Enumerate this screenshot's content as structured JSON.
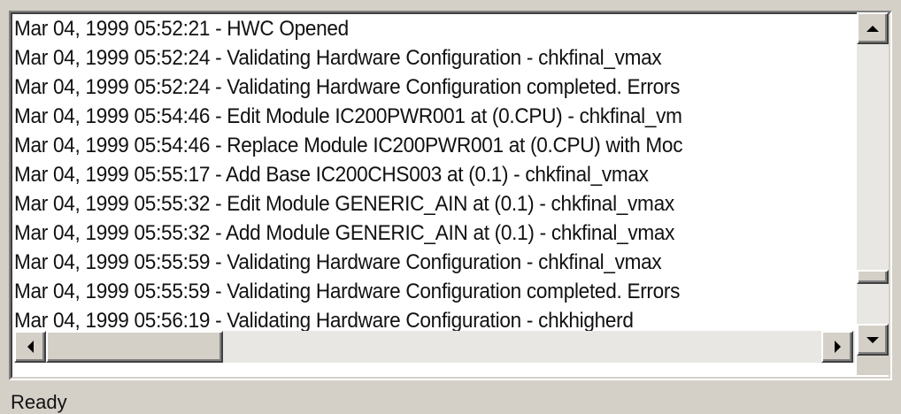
{
  "log": {
    "lines": [
      "Mar 04, 1999 05:52:21 - HWC Opened",
      "Mar 04, 1999 05:52:24 - Validating Hardware Configuration - chkfinal_vmax",
      "Mar 04, 1999 05:52:24 - Validating Hardware Configuration completed. Errors",
      "Mar 04, 1999 05:54:46 - Edit Module IC200PWR001 at (0.CPU) - chkfinal_vm",
      "Mar 04, 1999 05:54:46 - Replace Module IC200PWR001 at (0.CPU) with Moc",
      "Mar 04, 1999 05:55:17 - Add Base IC200CHS003 at (0.1) - chkfinal_vmax",
      "Mar 04, 1999 05:55:32 - Edit Module GENERIC_AIN at (0.1) - chkfinal_vmax",
      "Mar 04, 1999 05:55:32 - Add Module GENERIC_AIN at (0.1) - chkfinal_vmax",
      "Mar 04, 1999 05:55:59 - Validating Hardware Configuration - chkfinal_vmax",
      "Mar 04, 1999 05:55:59 - Validating Hardware Configuration completed. Errors",
      "Mar 04, 1999 05:56:19 - Validating Hardware Configuration - chkhigherd"
    ]
  },
  "scrollbars": {
    "vertical": {
      "position": 0.85
    },
    "horizontal": {
      "position": 0.0
    }
  },
  "status": {
    "text": "Ready"
  },
  "icons": {
    "scroll_up": "up-arrow-icon",
    "scroll_down": "down-arrow-icon",
    "scroll_left": "left-arrow-icon",
    "scroll_right": "right-arrow-icon"
  },
  "colors": {
    "window_bg": "#d4d0c8",
    "text_bg": "#ffffff",
    "text": "#111111"
  }
}
